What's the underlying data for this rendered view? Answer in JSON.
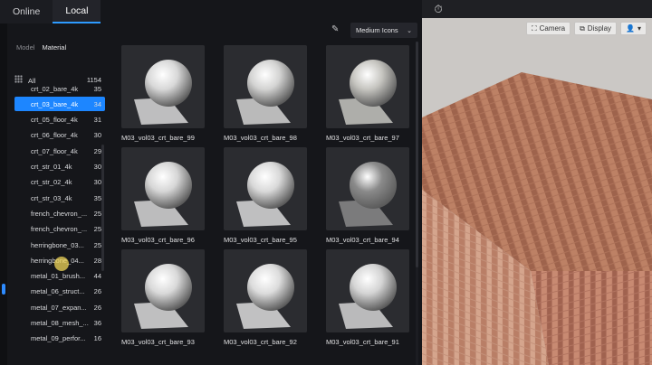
{
  "tabs": [
    {
      "label": "Online",
      "active": false
    },
    {
      "label": "Local",
      "active": true
    }
  ],
  "subtabs": [
    {
      "label": "Model",
      "active": false
    },
    {
      "label": "Material",
      "active": true
    }
  ],
  "categories": [
    {
      "label": "All",
      "count": "1154"
    },
    {
      "label": "crt_02_bare_4k",
      "count": "35"
    },
    {
      "label": "crt_03_bare_4k",
      "count": "34",
      "selected": true
    },
    {
      "label": "crt_05_floor_4k",
      "count": "31"
    },
    {
      "label": "crt_06_floor_4k",
      "count": "30"
    },
    {
      "label": "crt_07_floor_4k",
      "count": "29"
    },
    {
      "label": "crt_str_01_4k",
      "count": "30"
    },
    {
      "label": "crt_str_02_4k",
      "count": "30"
    },
    {
      "label": "crt_str_03_4k",
      "count": "35"
    },
    {
      "label": "french_chevron_...",
      "count": "25"
    },
    {
      "label": "french_chevron_...",
      "count": "25"
    },
    {
      "label": "herringbone_03...",
      "count": "25"
    },
    {
      "label": "herringbone_04...",
      "count": "28"
    },
    {
      "label": "metal_01_brush...",
      "count": "44"
    },
    {
      "label": "metal_06_struct...",
      "count": "26"
    },
    {
      "label": "metal_07_expan...",
      "count": "26"
    },
    {
      "label": "metal_08_mesh_...",
      "count": "36"
    },
    {
      "label": "metal_09_perfor...",
      "count": "16"
    }
  ],
  "view_mode": "Medium Icons",
  "thumbnails": [
    {
      "label": "M03_vol03_crt_bare_99",
      "tone": "#d8d8d8"
    },
    {
      "label": "M03_vol03_crt_bare_98",
      "tone": "#d3d3d2"
    },
    {
      "label": "M03_vol03_crt_bare_97",
      "tone": "#c6c5c0"
    },
    {
      "label": "M03_vol03_crt_bare_96",
      "tone": "#d6d6d6"
    },
    {
      "label": "M03_vol03_crt_bare_95",
      "tone": "#d9d9d9"
    },
    {
      "label": "M03_vol03_crt_bare_94",
      "tone": "#8a8a8a"
    },
    {
      "label": "M03_vol03_crt_bare_93",
      "tone": "#d9d9d9"
    },
    {
      "label": "M03_vol03_crt_bare_92",
      "tone": "#dcdcdc"
    },
    {
      "label": "M03_vol03_crt_bare_91",
      "tone": "#d4d4d4"
    }
  ],
  "viewport": {
    "camera_label": "Camera",
    "display_label": "Display"
  },
  "icons": {
    "pencil": "pencil-icon",
    "dropdown": "chevron-down-icon",
    "grid": "grid-icon",
    "camera": "camera-icon",
    "display": "display-icon",
    "user": "user-icon",
    "timer": "timer-icon"
  }
}
